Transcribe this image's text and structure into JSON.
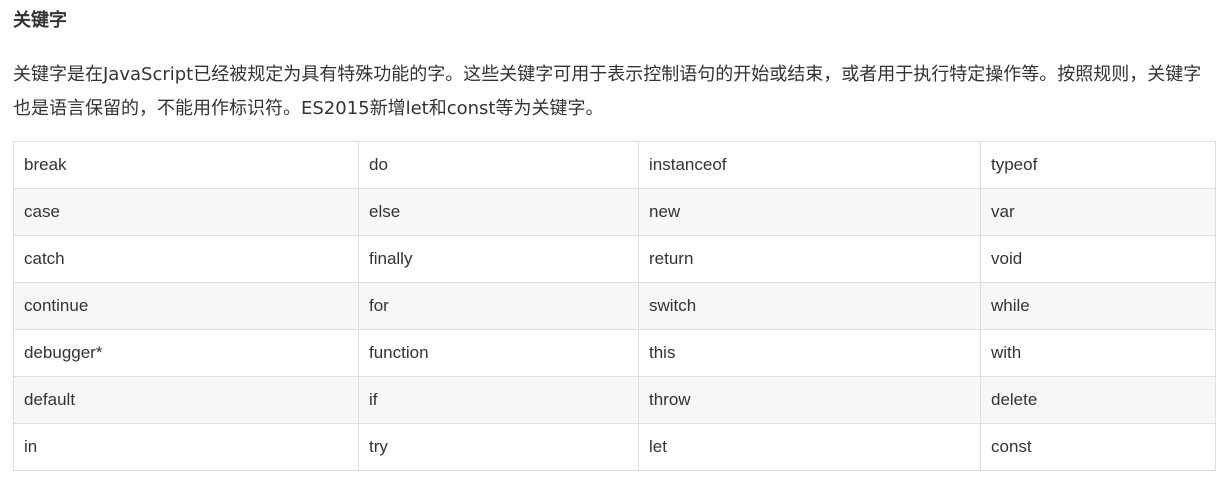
{
  "heading": "关键字",
  "paragraph": "关键字是在JavaScript已经被规定为具有特殊功能的字。这些关键字可用于表示控制语句的开始或结束，或者用于执行特定操作等。按照规则，关键字也是语言保留的，不能用作标识符。ES2015新增let和const等为关键字。",
  "keywords_table": {
    "rows": [
      [
        "break",
        "do",
        "instanceof",
        "typeof"
      ],
      [
        "case",
        "else",
        "new",
        "var"
      ],
      [
        "catch",
        "finally",
        "return",
        "void"
      ],
      [
        "continue",
        "for",
        "switch",
        "while"
      ],
      [
        "debugger*",
        "function",
        "this",
        "with"
      ],
      [
        "default",
        "if",
        "throw",
        "delete"
      ],
      [
        "in",
        "try",
        "let",
        "const"
      ]
    ]
  }
}
